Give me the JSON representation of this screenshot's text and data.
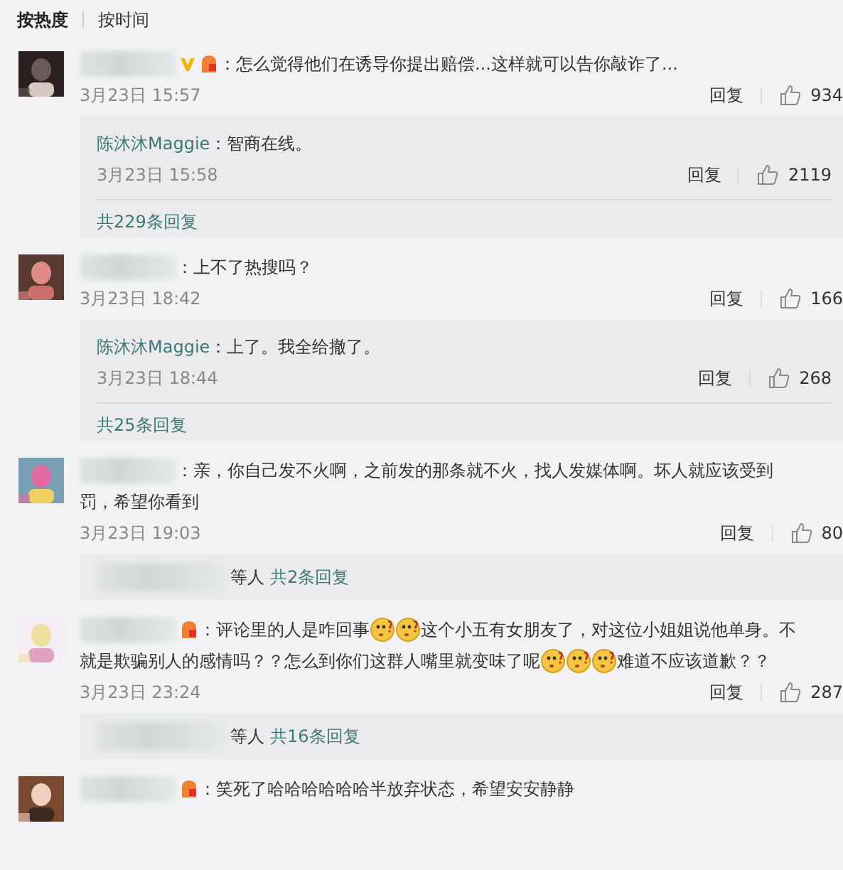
{
  "tabs": [
    {
      "label": "按热度",
      "selected": true
    },
    {
      "label": "按时间",
      "selected": false
    }
  ],
  "comments": [
    {
      "avatar": {
        "kind": "picture"
      },
      "verified": true,
      "badge": true,
      "lines": [
        [
          {
            "kind": "text",
            "text": "：怎么觉得他们在诱导你提出赔偿...这样就可以告你敲诈了..."
          }
        ]
      ],
      "time": "3月23日 15:57",
      "reply_label": "回复",
      "likes": "934",
      "replies": {
        "kind": "list",
        "items": [
          {
            "name": "陈沐沐Maggie",
            "text": "：智商在线。",
            "time": "3月23日 15:58",
            "reply_label": "回复",
            "likes": "2119"
          }
        ],
        "total": "共229条回复"
      }
    },
    {
      "avatar": {
        "kind": "picture"
      },
      "verified": false,
      "badge": false,
      "lines": [
        [
          {
            "kind": "text",
            "text": "：上不了热搜吗？"
          }
        ]
      ],
      "time": "3月23日 18:42",
      "reply_label": "回复",
      "likes": "166",
      "replies": {
        "kind": "list",
        "items": [
          {
            "name": "陈沐沐Maggie",
            "text": "：上了。我全给撤了。",
            "time": "3月23日 18:44",
            "reply_label": "回复",
            "likes": "268"
          }
        ],
        "total": "共25条回复"
      }
    },
    {
      "avatar": {
        "kind": "picture"
      },
      "verified": false,
      "badge": false,
      "lines": [
        [
          {
            "kind": "text",
            "text": "：亲，你自己发不火啊，之前发的那条就不火，找人发媒体啊。坏人就应该受到"
          }
        ],
        [
          {
            "kind": "text",
            "text": "罚，希望你看到"
          }
        ]
      ],
      "time": "3月23日 19:03",
      "reply_label": "回复",
      "likes": "80",
      "replies": {
        "kind": "summary",
        "suffix": "等人",
        "total": "共2条回复"
      }
    },
    {
      "avatar": {
        "kind": "picture"
      },
      "verified": false,
      "badge": true,
      "lines": [
        [
          {
            "kind": "text",
            "text": "：评论里的人是咋回事"
          },
          {
            "kind": "emoji"
          },
          {
            "kind": "emoji"
          },
          {
            "kind": "text",
            "text": "这个小五有女朋友了，对这位小姐姐说他单身。不"
          }
        ],
        [
          {
            "kind": "text",
            "text": "就是欺骗别人的感情吗？？怎么到你们这群人嘴里就变味了呢"
          },
          {
            "kind": "emoji"
          },
          {
            "kind": "emoji"
          },
          {
            "kind": "emoji"
          },
          {
            "kind": "text",
            "text": "难道不应该道歉？？"
          }
        ]
      ],
      "time": "3月23日 23:24",
      "reply_label": "回复",
      "likes": "287",
      "replies": {
        "kind": "summary",
        "suffix": "等人",
        "total": "共16条回复"
      }
    },
    {
      "avatar": {
        "kind": "picture"
      },
      "verified": false,
      "badge": true,
      "lines": [
        [
          {
            "kind": "text",
            "text": "：笑死了哈哈哈哈哈哈半放弃状态，希望安安静静"
          }
        ]
      ]
    }
  ]
}
